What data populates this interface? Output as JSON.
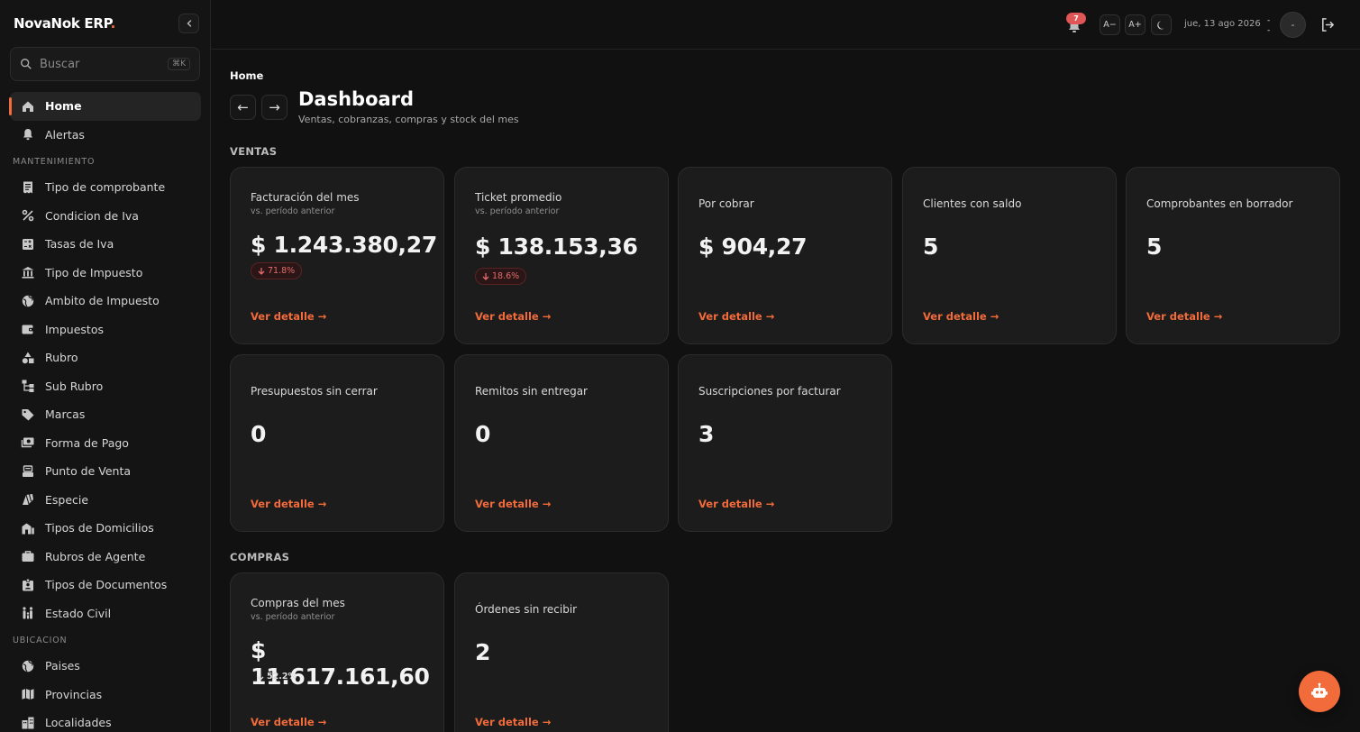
{
  "brand": {
    "name": "NovaNok ERP",
    "dot": "."
  },
  "search": {
    "placeholder": "Buscar",
    "shortcut": "⌘K"
  },
  "sidebar": {
    "top_items": [
      {
        "label": "Home",
        "icon": "home-icon",
        "active": true
      },
      {
        "label": "Alertas",
        "icon": "bell-icon"
      }
    ],
    "section_mantenimiento": "MANTENIMIENTO",
    "mantenimiento_items": [
      {
        "label": "Tipo de comprobante",
        "icon": "receipt-icon"
      },
      {
        "label": "Condicion de Iva",
        "icon": "percent-icon"
      },
      {
        "label": "Tasas de Iva",
        "icon": "calculator-icon"
      },
      {
        "label": "Tipo de Impuesto",
        "icon": "bank-icon"
      },
      {
        "label": "Ambito de Impuesto",
        "icon": "globe-icon"
      },
      {
        "label": "Impuestos",
        "icon": "wallet-icon"
      },
      {
        "label": "Rubro",
        "icon": "category-icon"
      },
      {
        "label": "Sub Rubro",
        "icon": "tree-icon"
      },
      {
        "label": "Marcas",
        "icon": "tag-icon"
      },
      {
        "label": "Forma de Pago",
        "icon": "payments-icon"
      },
      {
        "label": "Punto de Venta",
        "icon": "register-icon"
      },
      {
        "label": "Especie",
        "icon": "species-icon"
      },
      {
        "label": "Tipos de Domicilios",
        "icon": "building-icon"
      },
      {
        "label": "Rubros de Agente",
        "icon": "briefcase-icon"
      },
      {
        "label": "Tipos de Documentos",
        "icon": "id-badge-icon"
      },
      {
        "label": "Estado Civil",
        "icon": "family-icon"
      }
    ],
    "section_ubicacion": "UBICACION",
    "ubicacion_items": [
      {
        "label": "Paises",
        "icon": "globe-icon"
      },
      {
        "label": "Provincias",
        "icon": "map-icon"
      },
      {
        "label": "Localidades",
        "icon": "city-icon"
      }
    ]
  },
  "topbar": {
    "notifications": "7",
    "font_decrease": "A−",
    "font_increase": "A+",
    "date": "jue, 13 ago 2026",
    "user_line1": "-",
    "user_line2": "-",
    "avatar": "-"
  },
  "page": {
    "breadcrumb": "Home",
    "title": "Dashboard",
    "subtitle": "Ventas, cobranzas, compras y stock del mes",
    "back": "←",
    "forward": "→"
  },
  "sections": {
    "ventas": "VENTAS",
    "compras": "COMPRAS"
  },
  "link_label": "Ver detalle",
  "link_arrow": "→",
  "cards": [
    {
      "title": "Facturación del mes",
      "subtitle": "vs. período anterior",
      "value": "$ 1.243.380,27",
      "trend": "71.8%",
      "trend_dir": "down"
    },
    {
      "title": "Ticket promedio",
      "subtitle": "vs. período anterior",
      "value": "$ 138.153,36",
      "trend": "18.6%",
      "trend_dir": "down"
    },
    {
      "title": "Por cobrar",
      "value": "$ 904,27"
    },
    {
      "title": "Clientes con saldo",
      "value": "5"
    },
    {
      "title": "Comprobantes en borrador",
      "value": "5"
    },
    {
      "title": "Presupuestos sin cerrar",
      "value": "0"
    },
    {
      "title": "Remitos sin entregar",
      "value": "0"
    },
    {
      "title": "Suscripciones por facturar",
      "value": "3"
    },
    {
      "title": "Compras del mes",
      "subtitle": "vs. período anterior",
      "value": "$ 11.617.161,60",
      "trend": "52.2%",
      "trend_dir": "plain"
    },
    {
      "title": "Órdenes sin recibir",
      "value": "2"
    }
  ],
  "colors": {
    "accent": "#f26b3a",
    "background": "#111111",
    "card": "#1c1c1c",
    "trend_down": "#e36b6b"
  }
}
